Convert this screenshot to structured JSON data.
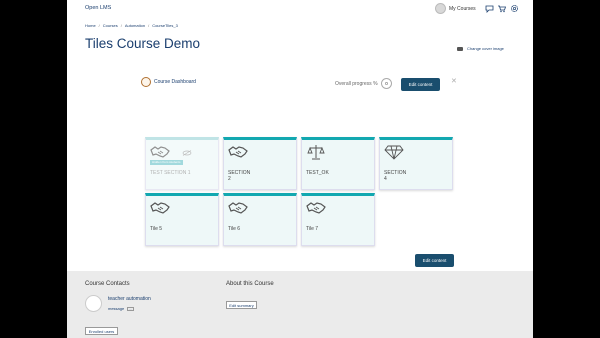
{
  "navbar": {
    "brand": "Open LMS",
    "my_courses": "My Courses",
    "icons": [
      "avatar",
      "chat-icon",
      "cart-icon",
      "gear-icon"
    ]
  },
  "breadcrumb": [
    "Home",
    "Courses",
    "Automation",
    "CourseTiles_3"
  ],
  "page_title": "Tiles Course Demo",
  "cover_link": "Change cover image",
  "dashboard": {
    "label": "Course Dashboard",
    "progress_label": "Overall progress %",
    "progress_value": "0",
    "edit_button": "Edit content"
  },
  "tiles": [
    {
      "label": "TEST SECTION 1",
      "icon": "handshake-icon",
      "hidden": true,
      "badge": "Hidden from students"
    },
    {
      "label": "SECTION\n2",
      "icon": "handshake-icon",
      "hidden": false
    },
    {
      "label": "TEST_OK",
      "icon": "scales-icon",
      "hidden": false
    },
    {
      "label": "SECTION\n4",
      "icon": "diamond-icon",
      "hidden": false
    },
    {
      "label": "Tile 5",
      "icon": "handshake-icon",
      "hidden": false
    },
    {
      "label": "Tile 6",
      "icon": "handshake-icon",
      "hidden": false
    },
    {
      "label": "Tile 7",
      "icon": "handshake-icon",
      "hidden": false
    }
  ],
  "bottom_edit_button": "Edit content",
  "footer": {
    "contacts_heading": "Course Contacts",
    "teacher_name": "teacher automation",
    "message_label": "message",
    "about_heading": "About this Course",
    "edit_summary": "Edit summary",
    "enrolled_users": "Enrolled users"
  },
  "colors": {
    "brand": "#1a3e6e",
    "tile_accent": "#12a8b0",
    "button": "#1a4e6e"
  }
}
